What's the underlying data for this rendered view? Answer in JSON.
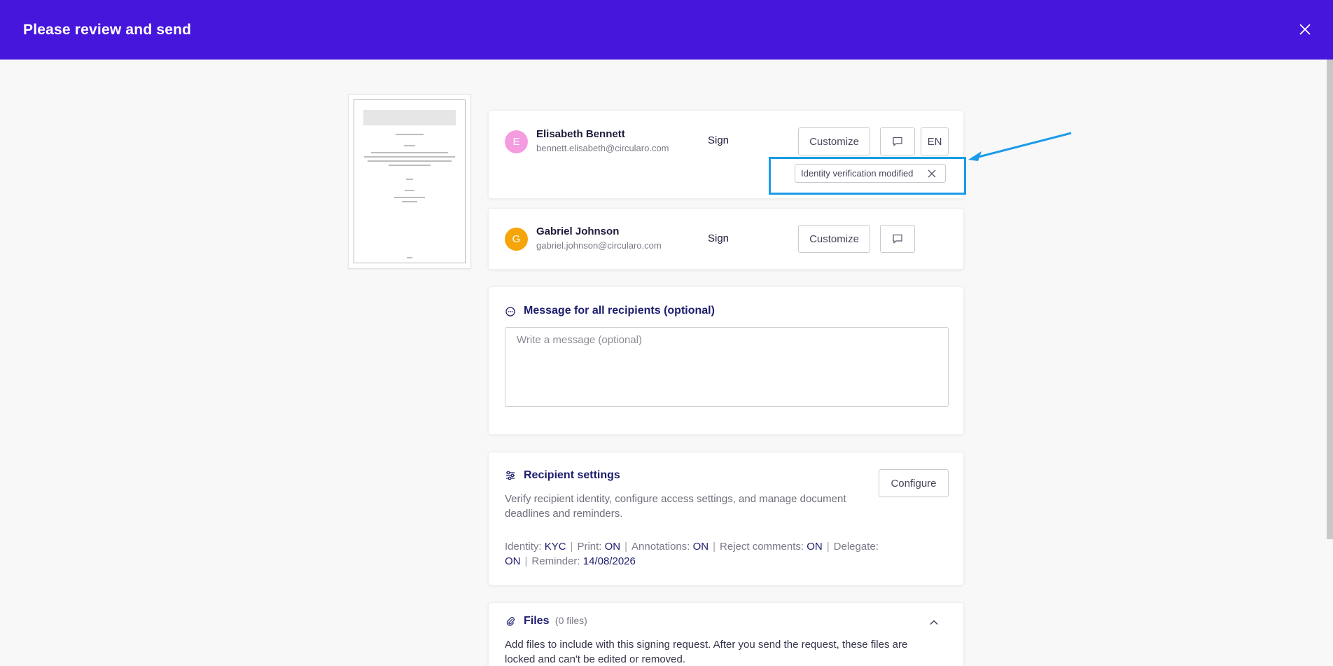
{
  "header": {
    "title": "Please review and send",
    "close_icon": "close-icon"
  },
  "recipients": [
    {
      "initial": "E",
      "avatar_color": "#f59ce0",
      "name": "Elisabeth Bennett",
      "email": "bennett.elisabeth@circularo.com",
      "role": "Sign",
      "customize_label": "Customize",
      "language": "EN",
      "tag": "Identity verification modified"
    },
    {
      "initial": "G",
      "avatar_color": "#f5a50a",
      "name": "Gabriel Johnson",
      "email": "gabriel.johnson@circularo.com",
      "role": "Sign",
      "customize_label": "Customize"
    }
  ],
  "message": {
    "title": "Message for all recipients (optional)",
    "placeholder": "Write a message (optional)"
  },
  "settings": {
    "title": "Recipient settings",
    "configure_label": "Configure",
    "description": "Verify recipient identity, configure access settings, and manage document deadlines and reminders.",
    "items": [
      {
        "label": "Identity:",
        "value": "KYC"
      },
      {
        "label": "Print:",
        "value": "ON"
      },
      {
        "label": "Annotations:",
        "value": "ON"
      },
      {
        "label": "Reject comments:",
        "value": "ON"
      },
      {
        "label": "Delegate:",
        "value": "ON"
      },
      {
        "label": "Reminder:",
        "value": "14/08/2026"
      }
    ]
  },
  "files": {
    "title": "Files",
    "count": "(0 files)",
    "description": "Add files to include with this signing request. After you send the request, these files are locked and can't be edited or removed."
  },
  "colors": {
    "header": "#4616dc",
    "accent_navy": "#1d1d6e",
    "highlight": "#1a9be8"
  }
}
